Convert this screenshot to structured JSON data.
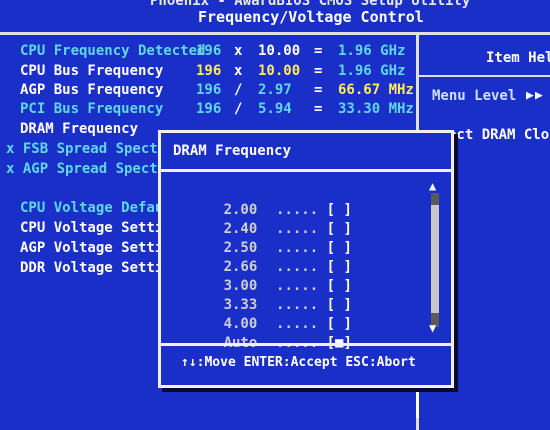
{
  "header": {
    "top_text": "Phoenix - AwardBIOS CMOS Setup Utility",
    "title": "Frequency/Voltage Control"
  },
  "rows": [
    {
      "label": "CPU Frequency Detected",
      "v1": "196",
      "op": "x",
      "v2": "10.00",
      "eq": "=",
      "v3": "1.96 GHz"
    },
    {
      "label": "CPU Bus Frequency",
      "v1": "196",
      "op": "x",
      "v2": "10.00",
      "eq": "=",
      "v3": "1.96 GHz"
    },
    {
      "label": "AGP Bus Frequency",
      "v1": "196",
      "op": "/",
      "v2": "2.97",
      "eq": "=",
      "v3": "66.67 MHz"
    },
    {
      "label": "PCI Bus Frequency",
      "v1": "196",
      "op": "/",
      "v2": "5.94",
      "eq": "=",
      "v3": "33.30 MHz"
    },
    {
      "label": "DRAM Frequency"
    },
    {
      "label": "x FSB Spread Spectr"
    },
    {
      "label": "x AGP Spread Spectr"
    },
    {
      "label": "CPU Voltage Defau"
    },
    {
      "label": "CPU Voltage Setti"
    },
    {
      "label": "AGP Voltage Setti"
    },
    {
      "label": "DDR Voltage Setti"
    }
  ],
  "help": {
    "title": "Item Help",
    "menu_level": "Menu Level",
    "arrows": "▶",
    "description": "ect DRAM Cloc"
  },
  "popup": {
    "title": "DRAM Frequency",
    "options": [
      {
        "value": "2.00",
        "dots": ".....",
        "mark": "[ ]"
      },
      {
        "value": "2.40",
        "dots": ".....",
        "mark": "[ ]"
      },
      {
        "value": "2.50",
        "dots": ".....",
        "mark": "[ ]"
      },
      {
        "value": "2.66",
        "dots": ".....",
        "mark": "[ ]"
      },
      {
        "value": "3.00",
        "dots": ".....",
        "mark": "[ ]"
      },
      {
        "value": "3.33",
        "dots": ".....",
        "mark": "[ ]"
      },
      {
        "value": "4.00",
        "dots": ".....",
        "mark": "[ ]"
      },
      {
        "value": "Auto",
        "dots": ".....",
        "mark": "[■]"
      }
    ],
    "footer": "↑↓:Move ENTER:Accept ESC:Abort",
    "scroll_up": "▲",
    "scroll_down": "▼"
  },
  "colors": {
    "background": "#1a2fc7",
    "cyan_text": "#5fd8e6",
    "white_text": "#ffffff",
    "highlight_text": "#ffee55"
  }
}
